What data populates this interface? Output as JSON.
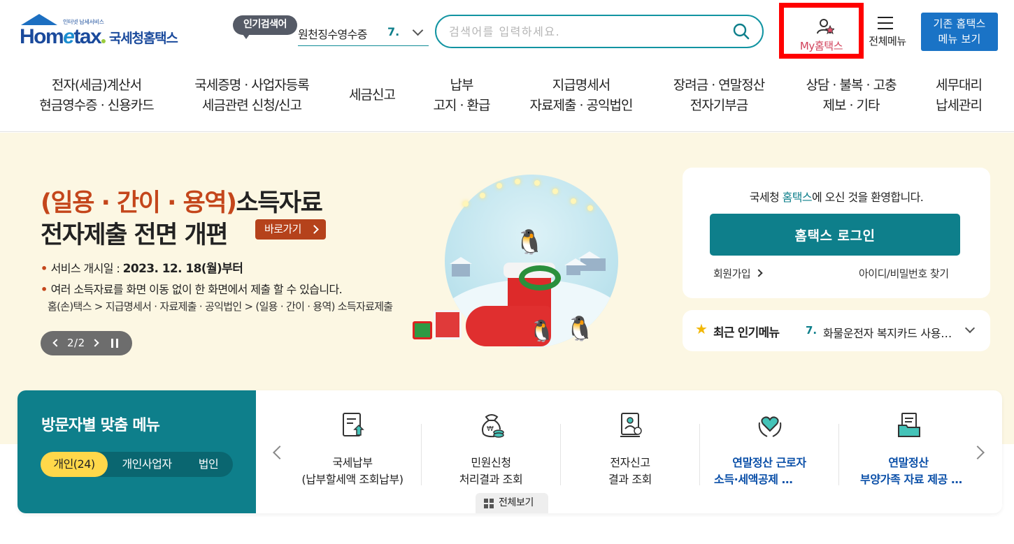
{
  "logo": {
    "tagline": "인터넷 납세서비스",
    "brand_a": "Hom",
    "brand_e": "e",
    "brand_b": "tax",
    "name": "국세청홈택스"
  },
  "header": {
    "popular_badge": "인기검색어",
    "popular_term": "원천징수영수증",
    "popular_rank": "7.",
    "search_placeholder": "검색어를 입력하세요.",
    "my_hometax": "My홈택스",
    "all_menu": "전체메뉴",
    "old_hometax_line1": "기존 홈택스",
    "old_hometax_line2": "메뉴 보기"
  },
  "gnb": [
    {
      "line1": "전자(세금)계산서",
      "line2": "현금영수증 · 신용카드"
    },
    {
      "line1": "국세증명 · 사업자등록",
      "line2": "세금관련 신청/신고"
    },
    {
      "line1": "세금신고",
      "line2": ""
    },
    {
      "line1": "납부",
      "line2": "고지 · 환급"
    },
    {
      "line1": "지급명세서",
      "line2": "자료제출 · 공익법인"
    },
    {
      "line1": "장려금 · 연말정산",
      "line2": "전자기부금"
    },
    {
      "line1": "상담 · 불복 · 고충",
      "line2": "제보 · 기타"
    },
    {
      "line1": "세무대리",
      "line2": "납세관리"
    }
  ],
  "banner": {
    "title_highlight": "(일용 · 간이 · 용역)",
    "title_rest": "소득자료",
    "title_line2": "전자제출 전면 개편",
    "go_button": "바로가기",
    "bullet": "•",
    "line1_label": "서비스 개시일 : ",
    "line1_value": "2023. 12. 18(월)부터",
    "line2": "여러 소득자료를 화면 이동 없이 한 화면에서 제출 할 수 있습니다.",
    "path": "홈(손)택스 > 지급명세서 · 자료제출 · 공익법인 > (일용 · 간이 · 용역) 소득자료제출",
    "page_indicator": "2/2"
  },
  "login": {
    "welcome_pre": "국세청 ",
    "welcome_hl": "홈택스",
    "welcome_post": "에 오신 것을 환영합니다.",
    "login_button": "홈택스 로그인",
    "join": "회원가입",
    "find": "아이디/비밀번호 찾기"
  },
  "recent": {
    "title": "최근 인기메뉴",
    "rank": "7.",
    "term": "화물운전자 복지카드 사용내역"
  },
  "visitor": {
    "title": "방문자별 맞춤 메뉴",
    "tabs": [
      "개인(24)",
      "개인사업자",
      "법인"
    ],
    "items": [
      {
        "line1": "국세납부",
        "line2": "(납부할세액 조회납부)",
        "icon": "tax-document-icon"
      },
      {
        "line1": "민원신청",
        "line2": "처리결과 조회",
        "icon": "money-bag-icon"
      },
      {
        "line1": "전자신고",
        "line2": "결과 조회",
        "icon": "e-filing-result-icon"
      },
      {
        "line1": "연말정산 근로자",
        "line2": "소득·세액공제 자료 조회",
        "icon": "heart-hands-icon"
      },
      {
        "line1": "연말정산",
        "line2": "부양가족 자료 제공 동의",
        "icon": "folder-document-icon"
      }
    ],
    "view_all": "전체보기"
  },
  "colors": {
    "teal": "#0e7f8b",
    "banner_bg": "#fcf7e3",
    "accent_red": "#c4461b",
    "highlight_box": "#ff0000",
    "tab_active": "#ffd84a"
  }
}
